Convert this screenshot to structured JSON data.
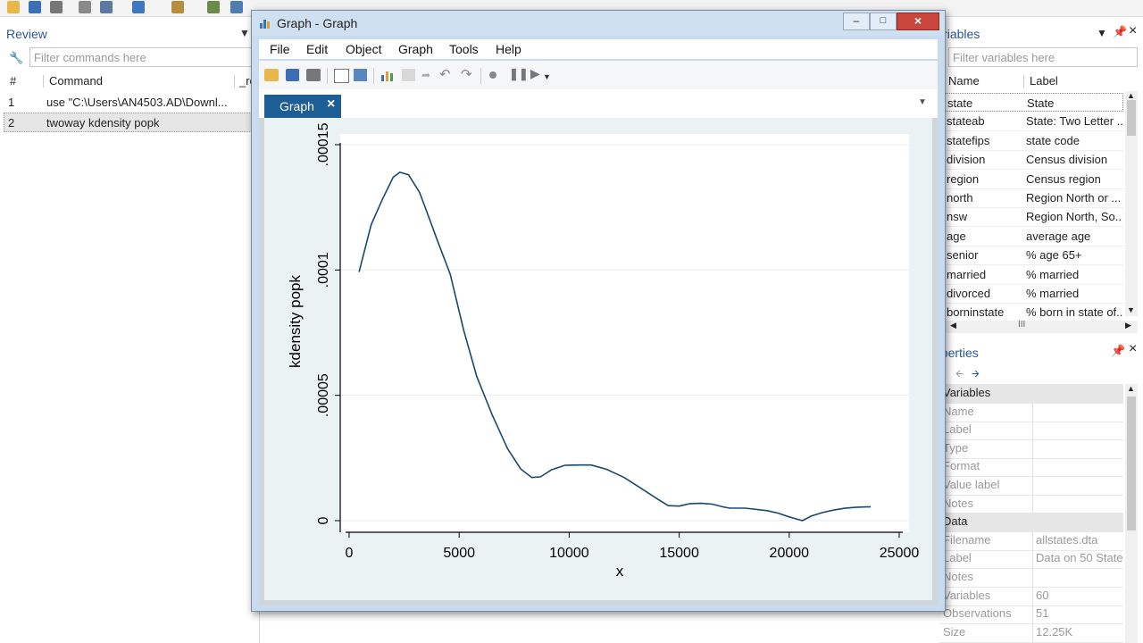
{
  "review": {
    "title": "Review",
    "filter_placeholder": "Filter commands here",
    "col_num": "#",
    "col_command": "Command",
    "col_rc": "_rc",
    "rows": [
      {
        "num": "1",
        "command": "use \"C:\\Users\\AN4503.AD\\Downl..."
      },
      {
        "num": "2",
        "command": "twoway kdensity popk"
      }
    ]
  },
  "graph_window": {
    "title": "Graph - Graph",
    "menu": [
      "File",
      "Edit",
      "Object",
      "Graph",
      "Tools",
      "Help"
    ],
    "tab_label": "Graph"
  },
  "chart_data": {
    "type": "line",
    "xlabel": "x",
    "ylabel": "kdensity popk",
    "xlim": [
      0,
      25000
    ],
    "ylim": [
      0,
      0.00015
    ],
    "xticks": [
      "0",
      "5000",
      "10000",
      "15000",
      "20000",
      "25000"
    ],
    "yticks": [
      "0",
      ".00005",
      ".0001",
      ".00015"
    ],
    "grid": "horizontal",
    "series": [
      {
        "x": [
          450,
          1000,
          1500,
          2000,
          2300,
          2700,
          3200,
          3500,
          4000,
          4600,
          5200,
          5800,
          6500,
          7200,
          7800,
          8300,
          8700,
          9200,
          9800,
          10500,
          11000,
          11700,
          12500,
          13200,
          14000,
          14500,
          15000,
          15500,
          16000,
          16500,
          17000,
          17300,
          18000,
          19000,
          19500,
          20000,
          20600,
          21000,
          21500,
          22000,
          22500,
          23000,
          23500,
          23700
        ],
        "y": [
          9.92e-05,
          0.000118,
          0.000128,
          0.000137,
          0.000139,
          0.000138,
          0.000131,
          0.000124,
          0.000112,
          9.82e-05,
          7.62e-05,
          5.75e-05,
          4.22e-05,
          2.87e-05,
          2.06e-05,
          1.72e-05,
          1.75e-05,
          2.03e-05,
          2.21e-05,
          2.22e-05,
          2.22e-05,
          2.05e-05,
          1.72e-05,
          1.33e-05,
          8.7e-06,
          6e-06,
          5.8e-06,
          6.8e-06,
          6.9e-06,
          6.6e-06,
          5.5e-06,
          5e-06,
          5e-06,
          4e-06,
          3e-06,
          1.5e-06,
          0.0,
          1.8e-06,
          3.2e-06,
          4.2e-06,
          4.9e-06,
          5.3e-06,
          5.5e-06,
          5.5e-06
        ]
      }
    ]
  },
  "variables": {
    "title": "Variables",
    "filter_placeholder": "Filter variables here",
    "col_name": "Name",
    "col_label": "Label",
    "rows": [
      {
        "name": "state",
        "label": "State"
      },
      {
        "name": "stateab",
        "label": "State: Two Letter ..."
      },
      {
        "name": "statefips",
        "label": "state code"
      },
      {
        "name": "division",
        "label": "Census division"
      },
      {
        "name": "region",
        "label": "Census region"
      },
      {
        "name": "north",
        "label": "Region North or ..."
      },
      {
        "name": "nsw",
        "label": "Region North, So..."
      },
      {
        "name": "age",
        "label": "average age"
      },
      {
        "name": "senior",
        "label": "% age 65+"
      },
      {
        "name": "married",
        "label": "% married"
      },
      {
        "name": "divorced",
        "label": "% married"
      },
      {
        "name": "borninstate",
        "label": "% born in state of..."
      }
    ],
    "scroll_thumb": "III"
  },
  "properties": {
    "title": "Properties",
    "section_variables": "Variables",
    "variable_fields": [
      "Name",
      "Label",
      "Type",
      "Format",
      "Value label",
      "Notes"
    ],
    "section_data": "Data",
    "data_fields": [
      {
        "label": "Filename",
        "value": "allstates.dta"
      },
      {
        "label": "Label",
        "value": "Data on 50 State"
      },
      {
        "label": "Notes",
        "value": ""
      },
      {
        "label": "Variables",
        "value": "60"
      },
      {
        "label": "Observations",
        "value": "51"
      },
      {
        "label": "Size",
        "value": "12.25K"
      }
    ]
  },
  "colors": {
    "accent": "#2b579a",
    "tab_active": "#1d5e94",
    "plot_region": "#eaf2f3",
    "line": "#1a476f"
  }
}
